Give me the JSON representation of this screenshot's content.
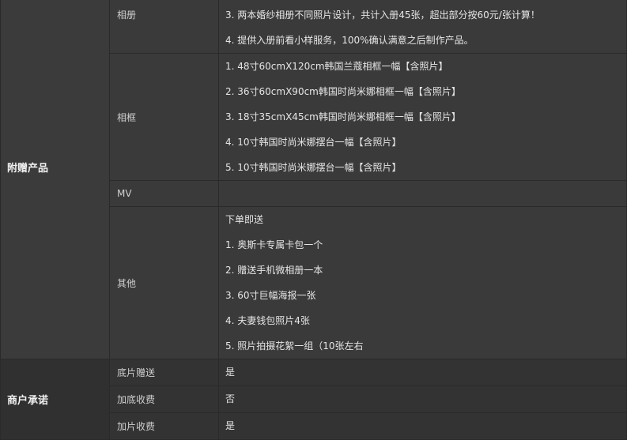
{
  "sections": {
    "gifts_label": "附赠产品",
    "promise_label": "商户承诺"
  },
  "album": {
    "label": "相册",
    "lines": [
      "3. 两本婚纱相册不同照片设计，共计入册45张，超出部分按60元/张计算！",
      "4. 提供入册前看小样服务，100%确认满意之后制作产品。"
    ]
  },
  "frame": {
    "label": "相框",
    "lines": [
      "1. 48寸60cmX120cm韩国兰蔻相框一幅【含照片】",
      "2. 36寸60cmX90cm韩国时尚米娜相框一幅【含照片】",
      "3. 18寸35cmX45cm韩国时尚米娜相框一幅【含照片】",
      "4. 10寸韩国时尚米娜摆台一幅【含照片】",
      "5. 10寸韩国时尚米娜摆台一幅【含照片】"
    ]
  },
  "mv": {
    "label": "MV",
    "value": ""
  },
  "other": {
    "label": "其他",
    "lines": [
      "下单即送",
      "1. 奥斯卡专属卡包一个",
      "2. 赠送手机微相册一本",
      "3. 60寸巨幅海报一张",
      "4. 夫妻钱包照片4张",
      "5. 照片拍摄花絮一组（10张左右"
    ]
  },
  "promises": [
    {
      "label": "底片赠送",
      "value": "是"
    },
    {
      "label": "加底收费",
      "value": "否"
    },
    {
      "label": "加片收费",
      "value": "是"
    }
  ]
}
